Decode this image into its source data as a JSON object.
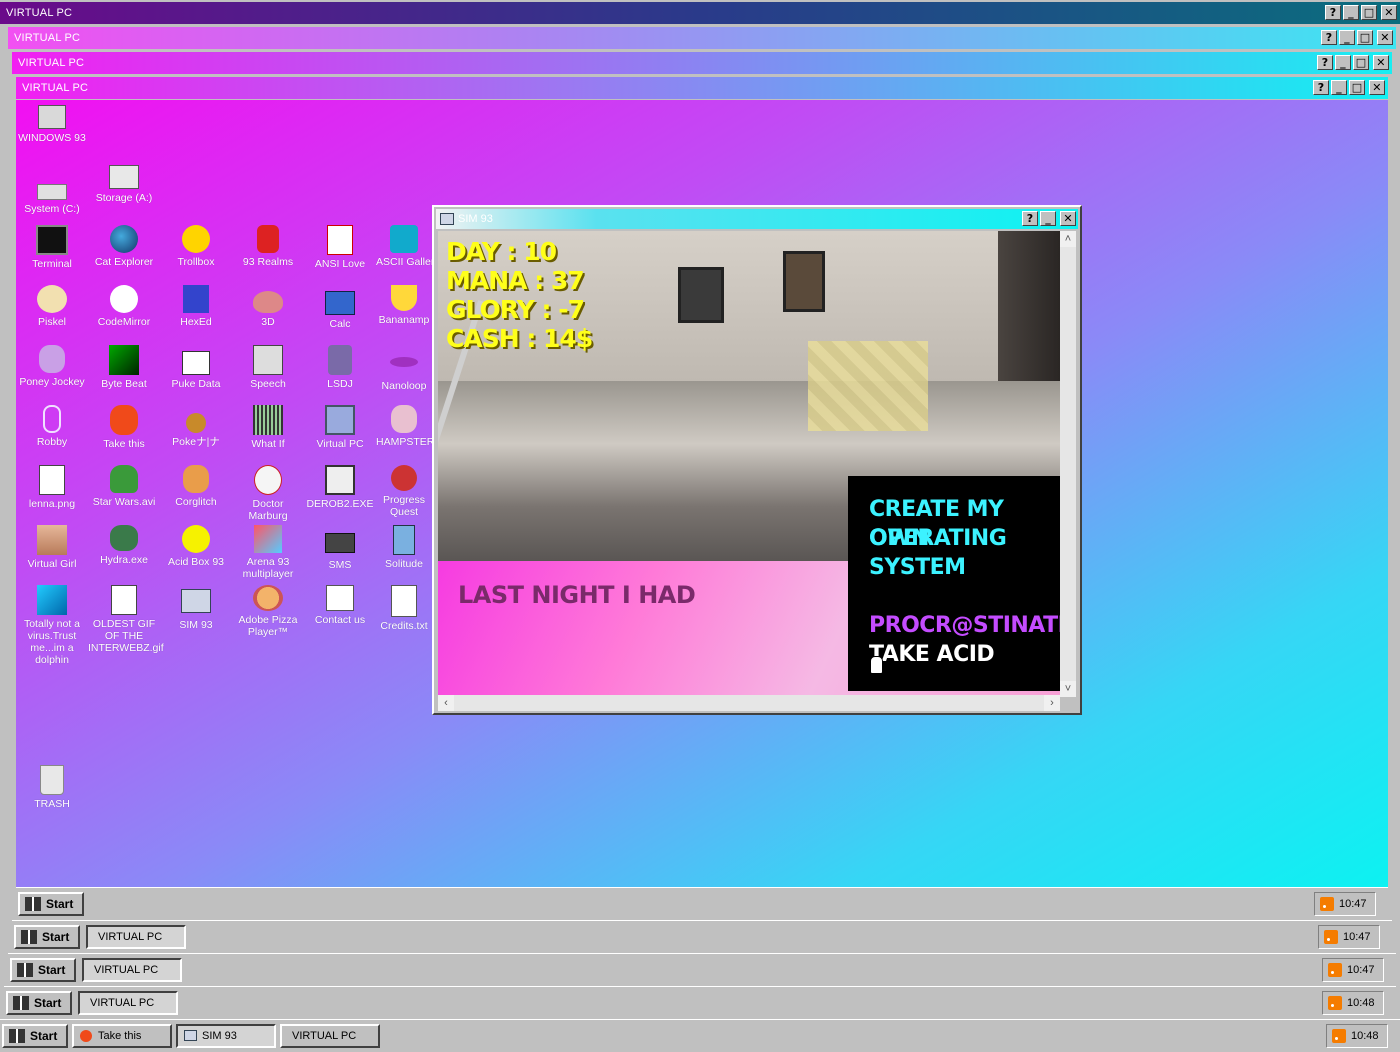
{
  "windows": [
    {
      "title": "VIRTUAL PC"
    },
    {
      "title": "VIRTUAL PC"
    },
    {
      "title": "VIRTUAL PC"
    },
    {
      "title": "VIRTUAL PC"
    }
  ],
  "title_buttons": {
    "help": "?",
    "minimize": "_",
    "maximize": "□",
    "close": "✕"
  },
  "desktop_icons": [
    {
      "label": "WINDOWS 93",
      "icon": "computer-icon"
    },
    {
      "label": "System (C:)",
      "icon": "drive-icon"
    },
    {
      "label": "Storage (A:)",
      "icon": "floppy-drive-icon"
    },
    {
      "label": "Terminal",
      "icon": "terminal-icon"
    },
    {
      "label": "Cat Explorer",
      "icon": "globe-icon"
    },
    {
      "label": "Trollbox",
      "icon": "chat-icon"
    },
    {
      "label": "93 Realms",
      "icon": "realms-icon"
    },
    {
      "label": "ANSI Love",
      "icon": "ansi-icon"
    },
    {
      "label": "ASCII Gallery",
      "icon": "ascii-icon"
    },
    {
      "label": "Piskel",
      "icon": "palette-icon"
    },
    {
      "label": "CodeMirror",
      "icon": "codemirror-icon"
    },
    {
      "label": "HexEd",
      "icon": "hex-icon"
    },
    {
      "label": "3D",
      "icon": "teapot-icon"
    },
    {
      "label": "Calc",
      "icon": "calculator-icon"
    },
    {
      "label": "Bananamp",
      "icon": "banana-icon"
    },
    {
      "label": "Poney Jockey",
      "icon": "pony-icon"
    },
    {
      "label": "Byte Beat",
      "icon": "bytebeat-icon"
    },
    {
      "label": "Puke Data",
      "icon": "pukedata-icon"
    },
    {
      "label": "Speech",
      "icon": "speech-icon"
    },
    {
      "label": "LSDJ",
      "icon": "gameboy-icon"
    },
    {
      "label": "Nanoloop",
      "icon": "nanoloop-icon"
    },
    {
      "label": "Robby",
      "icon": "robby-icon"
    },
    {
      "label": "Take this",
      "icon": "take-this-icon"
    },
    {
      "label": "Pokeナ|ナ",
      "icon": "pokemon-icon"
    },
    {
      "label": "What If",
      "icon": "what-if-icon"
    },
    {
      "label": "Virtual PC",
      "icon": "virtual-pc-icon"
    },
    {
      "label": "HAMPSTER",
      "icon": "hampster-icon"
    },
    {
      "label": "lenna.png",
      "icon": "image-file-icon"
    },
    {
      "label": "Star Wars.avi",
      "icon": "yoda-icon"
    },
    {
      "label": "Corglitch",
      "icon": "corgi-icon"
    },
    {
      "label": "Doctor Marburg",
      "icon": "doctor-icon"
    },
    {
      "label": "DEROB2.EXE",
      "icon": "derob-icon"
    },
    {
      "label": "Progress Quest",
      "icon": "progress-quest-icon"
    },
    {
      "label": "Virtual Girl",
      "icon": "virtual-girl-icon"
    },
    {
      "label": "Hydra.exe",
      "icon": "hydra-icon"
    },
    {
      "label": "Acid Box 93",
      "icon": "smiley-icon"
    },
    {
      "label": "Arena 93 multiplayer",
      "icon": "cube-icon"
    },
    {
      "label": "SMS",
      "icon": "sms-icon"
    },
    {
      "label": "Solitude",
      "icon": "solitude-icon"
    },
    {
      "label": "Totally not a virus.Trust me...im a dolphin",
      "icon": "dolphin-icon"
    },
    {
      "label": "OLDEST GIF OF THE INTERWEBZ.gif",
      "icon": "gif-file-icon"
    },
    {
      "label": "SIM 93",
      "icon": "sim93-icon"
    },
    {
      "label": "Adobe Pizza Player™",
      "icon": "pizza-icon"
    },
    {
      "label": "Contact us",
      "icon": "contact-icon"
    },
    {
      "label": "Credits.txt",
      "icon": "text-file-icon"
    },
    {
      "label": "TRASH",
      "icon": "trash-icon"
    }
  ],
  "sim93": {
    "title": "SIM 93",
    "stats": {
      "day": "DAY : 10",
      "mana": "MANA : 37",
      "glory": "GLORY : -7",
      "cash": "CASH : 14$"
    },
    "prompt": "LAST NIGHT I HAD",
    "options": [
      "CREATE MY OWN",
      "OPERATING",
      "SYSTEM",
      "PROCR@STINATION",
      "TAKE ACID"
    ]
  },
  "taskbars": [
    {
      "start": "Start",
      "items": [],
      "time": "10:47"
    },
    {
      "start": "Start",
      "items": [
        "VIRTUAL PC"
      ],
      "time": "10:47"
    },
    {
      "start": "Start",
      "items": [
        "VIRTUAL PC"
      ],
      "time": "10:47"
    },
    {
      "start": "Start",
      "items": [
        "VIRTUAL PC"
      ],
      "time": "10:48"
    },
    {
      "start": "Start",
      "items": [
        "Take this",
        "SIM 93",
        "VIRTUAL PC"
      ],
      "time": "10:48"
    }
  ],
  "colors": {
    "accent_magenta": "#f20ff2",
    "accent_cyan": "#0cf2f2",
    "stat_yellow": "#ffff1a",
    "option_cyan": "#3cf2ff",
    "option_violet": "#c44cff"
  }
}
